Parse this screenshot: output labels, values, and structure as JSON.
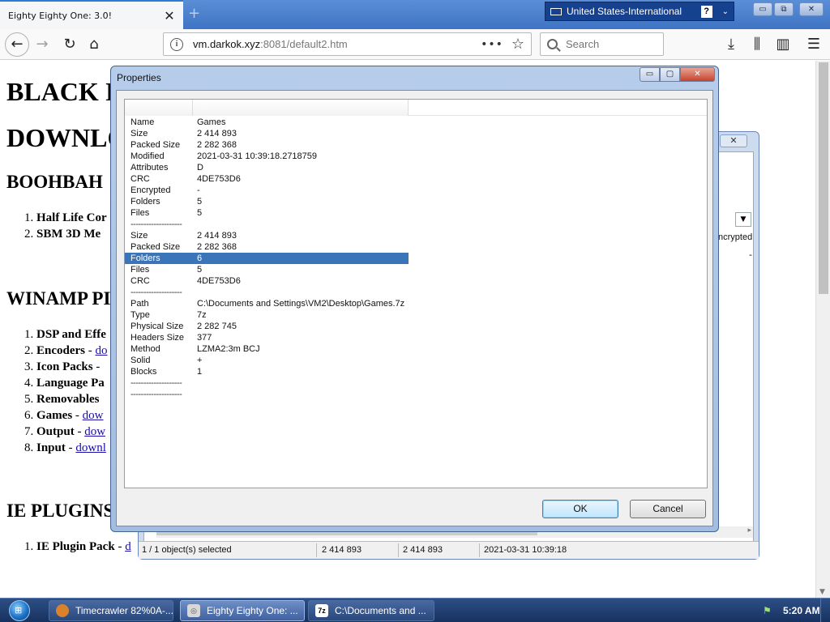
{
  "browser": {
    "tab_title": "Eighty Eighty One: 3.0!",
    "tab_close": "✕",
    "new_tab": "+",
    "url_host": "vm.darkok.xyz",
    "url_rest": ":8081/default2.htm",
    "search_placeholder": "Search",
    "page_actions": "•••",
    "icons": {
      "back": "←",
      "forward": "→",
      "reload": "↻",
      "home": "⌂",
      "star": "☆",
      "download": "⤓",
      "library": "⫼",
      "sidebar": "▥",
      "menu": "☰"
    }
  },
  "language_bar": {
    "label": "United States-International",
    "help": "?",
    "options": "⌄"
  },
  "window_controls": {
    "minimize": "▭",
    "maximize": "⧉",
    "close": "✕"
  },
  "page": {
    "headings": [
      "BLACK I",
      "DOWNLO"
    ],
    "section1": {
      "title": "BOOHBAH",
      "items": [
        {
          "num": "1.",
          "label": "Half Life Cor"
        },
        {
          "num": "2.",
          "label": "SBM 3D Me"
        }
      ]
    },
    "section2": {
      "title": "WINAMP PI",
      "items": [
        {
          "num": "1.",
          "label": "DSP and Effe",
          "link": ""
        },
        {
          "num": "2.",
          "label": "Encoders",
          "sep": " - ",
          "link": "do"
        },
        {
          "num": "3.",
          "label": "Icon Packs",
          "sep": " - ",
          "link": ""
        },
        {
          "num": "4.",
          "label": "Language Pa",
          "link": ""
        },
        {
          "num": "5.",
          "label": "Removables",
          "link": ""
        },
        {
          "num": "6.",
          "label": "Games",
          "sep": " - ",
          "link": "dow"
        },
        {
          "num": "7.",
          "label": "Output",
          "sep": " - ",
          "link": "dow"
        },
        {
          "num": "8.",
          "label": "Input",
          "sep": " - ",
          "link": "downl"
        }
      ]
    },
    "section3": {
      "title": "IE PLUGINS",
      "items": [
        {
          "num": "1.",
          "label": "IE Plugin Pack",
          "sep": " - ",
          "link": "d"
        }
      ]
    }
  },
  "file_manager": {
    "close": "✕",
    "combo_arrow": "▼",
    "column_encrypted": "ncrypted",
    "encrypted_value": "-",
    "scroll_right": "▸",
    "status": {
      "selection": "1 / 1 object(s) selected",
      "size": "2 414 893",
      "packed": "2 414 893",
      "modified": "2021-03-31 10:39:18"
    }
  },
  "properties": {
    "title": "Properties",
    "min": "▭",
    "max": "▢",
    "close": "✕",
    "ok_label": "OK",
    "cancel_label": "Cancel",
    "rows": [
      {
        "k": "Name",
        "v": "Games"
      },
      {
        "k": "Size",
        "v": "2 414 893"
      },
      {
        "k": "Packed Size",
        "v": "2 282 368"
      },
      {
        "k": "Modified",
        "v": "2021-03-31 10:39:18.2718759"
      },
      {
        "k": "Attributes",
        "v": "D"
      },
      {
        "k": "CRC",
        "v": "4DE753D6"
      },
      {
        "k": "Encrypted",
        "v": "-"
      },
      {
        "k": "Folders",
        "v": "5"
      },
      {
        "k": "Files",
        "v": "5"
      },
      {
        "k": "--------------------",
        "v": "",
        "sep": true
      },
      {
        "k": "Size",
        "v": "2 414 893"
      },
      {
        "k": "Packed Size",
        "v": "2 282 368"
      },
      {
        "k": "Folders",
        "v": "6",
        "selected": true
      },
      {
        "k": "Files",
        "v": "5"
      },
      {
        "k": "CRC",
        "v": "4DE753D6"
      },
      {
        "k": "--------------------",
        "v": "",
        "sep": true
      },
      {
        "k": "Path",
        "v": "C:\\Documents and Settings\\VM2\\Desktop\\Games.7z"
      },
      {
        "k": "Type",
        "v": "7z"
      },
      {
        "k": "Physical Size",
        "v": "2 282 745"
      },
      {
        "k": "Headers Size",
        "v": "377"
      },
      {
        "k": "Method",
        "v": "LZMA2:3m BCJ"
      },
      {
        "k": "Solid",
        "v": "+"
      },
      {
        "k": "Blocks",
        "v": "1"
      },
      {
        "k": "--------------------",
        "v": "",
        "sep": true
      },
      {
        "k": "--------------------",
        "v": "",
        "sep": true
      }
    ]
  },
  "taskbar": {
    "start_icon": "⊞",
    "tasks": [
      {
        "label": "Timecrawler 82%0A-...",
        "icon": ""
      },
      {
        "label": "Eighty Eighty One: ...",
        "icon": "◎"
      },
      {
        "label": "C:\\Documents and ...",
        "icon": "7z"
      }
    ],
    "tray_icon": "⚑",
    "clock": "5:20 AM"
  }
}
